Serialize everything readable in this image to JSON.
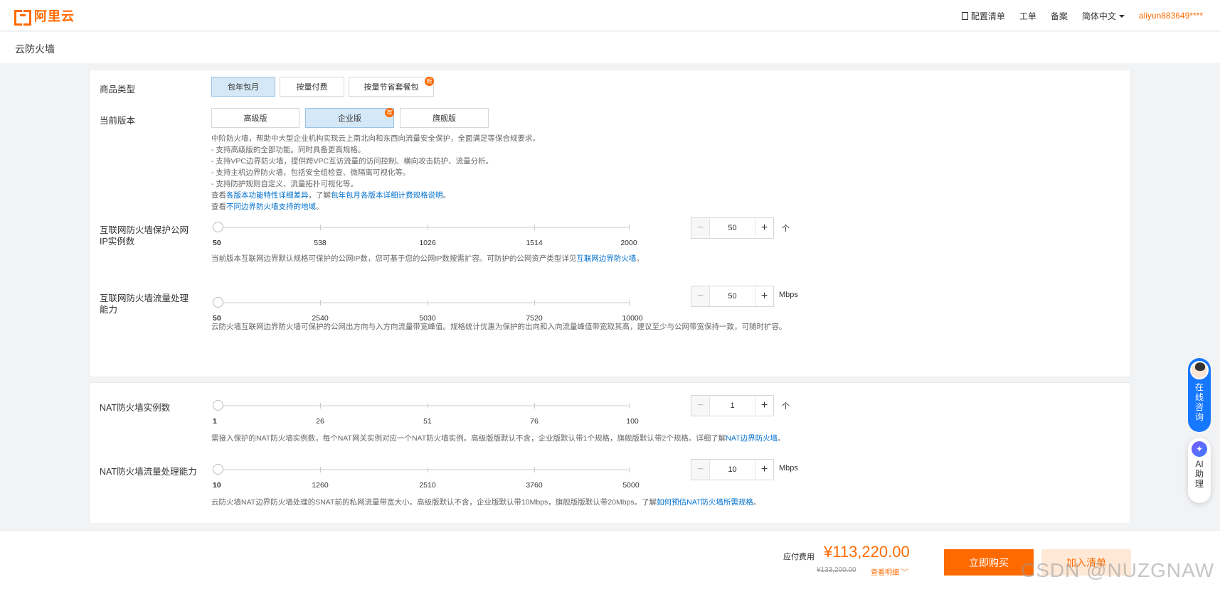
{
  "header": {
    "logo_text": "阿里云",
    "nav": {
      "config_list": "配置清单",
      "ticket": "工单",
      "record": "备案",
      "language": "简体中文",
      "user": "aliyun883649****"
    }
  },
  "page_title": "云防火墙",
  "product_type": {
    "label": "商品类型",
    "options": [
      "包年包月",
      "按量付费",
      "按量节省套餐包"
    ],
    "selected": "包年包月",
    "new_badge": "新"
  },
  "edition": {
    "label": "当前版本",
    "options": [
      "高级版",
      "企业版",
      "旗舰版"
    ],
    "selected": "企业版",
    "badge": "荐"
  },
  "edition_desc": {
    "lines": [
      "中阶防火墙，帮助中大型企业机构实现云上南北向和东西向流量安全保护，全面满足等保合规要求。",
      "- 支持高级版的全部功能。同时具备更高规格。",
      "- 支持VPC边界防火墙，提供跨VPC互访流量的访问控制、横向攻击防护、流量分析。",
      "- 支持主机边界防火墙，包括安全组检查、微隔离可视化等。",
      "- 支持防护规则自定义、流量拓扑可视化等。"
    ],
    "line6_prefix": "查看",
    "line6_link1": "各版本功能特性详细差异",
    "line6_mid": "，了解",
    "line6_link2": "包年包月各版本详细计费规格说明",
    "line6_suffix": "。",
    "line7_prefix": "查看",
    "line7_link": "不同边界防火墙支持的地域",
    "line7_suffix": "。"
  },
  "inet_ip": {
    "label": "互联网防火墙保护公网IP实例数",
    "ticks": [
      "50",
      "538",
      "1026",
      "1514",
      "2000"
    ],
    "value": "50",
    "unit": "个",
    "hint": "当前版本互联网边界默认规格可保护的公网IP数，您可基于您的公网IP数按需扩容。可防护的公网资产类型详见",
    "hint_link": "互联网边界防火墙",
    "hint_suffix": "。"
  },
  "inet_bw": {
    "label": "互联网防火墙流量处理能力",
    "ticks": [
      "50",
      "2540",
      "5030",
      "7520",
      "10000"
    ],
    "value": "50",
    "unit": "Mbps",
    "hint": "云防火墙互联网边界防火墙可保护的公网出方向与入方向流量带宽峰值。规格统计优惠为保护的出向和入向流量峰值带宽取其高，建议至少与公网带宽保持一致，可随时扩容。"
  },
  "nat_count": {
    "label": "NAT防火墙实例数",
    "ticks": [
      "1",
      "26",
      "51",
      "76",
      "100"
    ],
    "value": "1",
    "unit": "个",
    "hint": "需接入保护的NAT防火墙实例数，每个NAT网关实例对应一个NAT防火墙实例。高级版版默认不含，企业版默认带1个规格，旗舰版默认带2个规格。详细了解",
    "hint_link": "NAT边界防火墙",
    "hint_suffix": "。"
  },
  "nat_bw": {
    "label": "NAT防火墙流量处理能力",
    "ticks": [
      "10",
      "1260",
      "2510",
      "3760",
      "5000"
    ],
    "value": "10",
    "unit": "Mbps",
    "hint": "云防火墙NAT边界防火墙处理的SNAT前的私网流量带宽大小。高级版默认不含，企业版默认带10Mbps，旗舰版版默认带20Mbps。了解",
    "hint_link": "如何预估NAT防火墙所需规格",
    "hint_suffix": "。"
  },
  "footer": {
    "fee_label": "应付费用",
    "fee": "¥113,220.00",
    "original": "¥133,200.00",
    "detail": "查看明细",
    "buy": "立即购买",
    "cart": "加入清单",
    "watermark": "CSDN @NUZGNAW"
  },
  "floating": {
    "consult": "在线咨询",
    "ai_icon": "✦",
    "ai": "AI助理"
  },
  "icons": {
    "minus": "−",
    "plus": "+",
    "chevron": "﹀"
  },
  "colors": {
    "accent": "#ff6a00",
    "link": "#0070cc",
    "selected_bg": "#d5e8f7"
  }
}
